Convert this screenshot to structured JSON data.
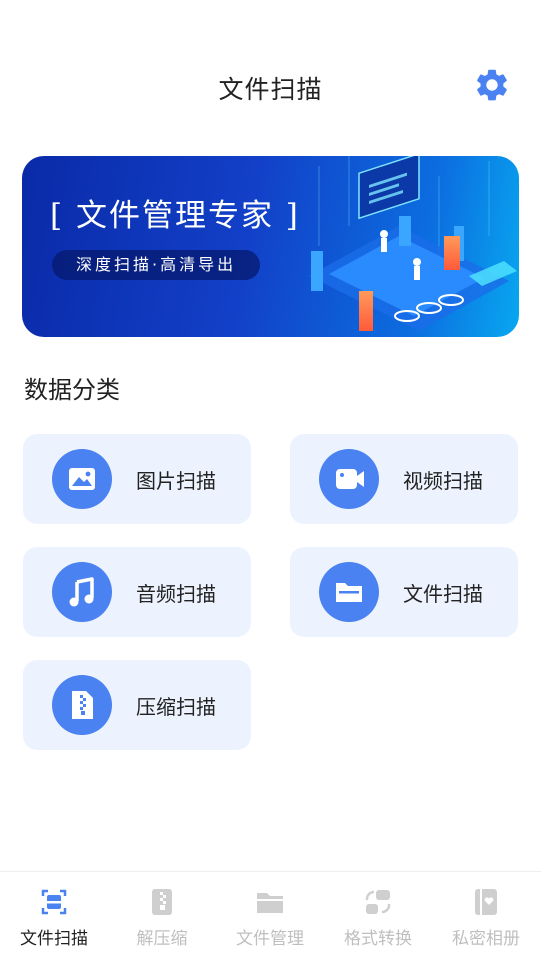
{
  "header": {
    "title": "文件扫描",
    "settings_icon": "gear-icon"
  },
  "banner": {
    "headline": "[ 文件管理专家 ]",
    "subtitle": "深度扫描·高清导出"
  },
  "section": {
    "title": "数据分类"
  },
  "categories": [
    {
      "label": "图片扫描",
      "icon": "image-icon"
    },
    {
      "label": "视频扫描",
      "icon": "video-icon"
    },
    {
      "label": "音频扫描",
      "icon": "music-icon"
    },
    {
      "label": "文件扫描",
      "icon": "folder-icon"
    },
    {
      "label": "压缩扫描",
      "icon": "zip-file-icon"
    }
  ],
  "tabbar": {
    "active_index": 0,
    "items": [
      {
        "label": "文件扫描",
        "icon": "scan-icon"
      },
      {
        "label": "解压缩",
        "icon": "zip-icon"
      },
      {
        "label": "文件管理",
        "icon": "folder-icon"
      },
      {
        "label": "格式转换",
        "icon": "convert-icon"
      },
      {
        "label": "私密相册",
        "icon": "album-icon"
      }
    ]
  },
  "colors": {
    "accent": "#4b82f1",
    "card_bg": "#edf3fe",
    "tab_inactive": "#bfbfbf",
    "banner_dark": "#0a2aa8"
  }
}
